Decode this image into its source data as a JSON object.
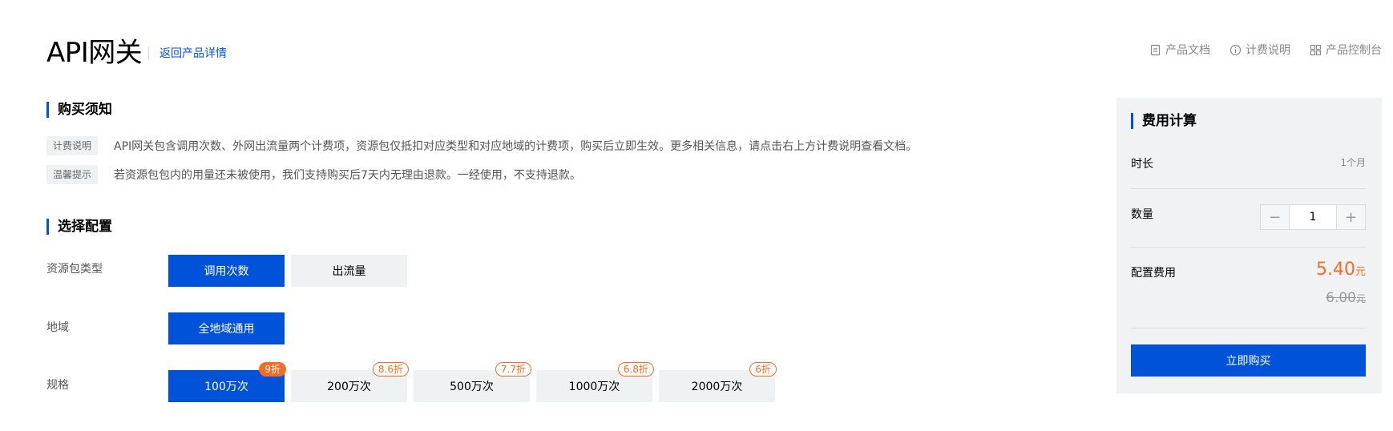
{
  "header": {
    "title": "API网关",
    "back_link": "返回产品详情",
    "links": [
      {
        "label": "产品文档",
        "icon": "doc-icon"
      },
      {
        "label": "计费说明",
        "icon": "info-icon"
      },
      {
        "label": "产品控制台",
        "icon": "grid-icon"
      }
    ]
  },
  "notice": {
    "title": "购买须知",
    "items": [
      {
        "tag": "计费说明",
        "text": "API网关包含调用次数、外网出流量两个计费项，资源包仅抵扣对应类型和对应地域的计费项，购买后立即生效。更多相关信息，请点击右上方计费说明查看文档。"
      },
      {
        "tag": "温馨提示",
        "text": "若资源包包内的用量还未被使用，我们支持购买后7天内无理由退款。一经使用，不支持退款。"
      }
    ]
  },
  "config": {
    "title": "选择配置",
    "package_type": {
      "label": "资源包类型",
      "options": [
        "调用次数",
        "出流量"
      ],
      "selected": "调用次数"
    },
    "region": {
      "label": "地域",
      "options": [
        "全地域通用"
      ],
      "selected": "全地域通用"
    },
    "spec": {
      "label": "规格",
      "options": [
        {
          "label": "100万次",
          "discount": "9折"
        },
        {
          "label": "200万次",
          "discount": "8.6折"
        },
        {
          "label": "500万次",
          "discount": "7.7折"
        },
        {
          "label": "1000万次",
          "discount": "6.8折"
        },
        {
          "label": "2000万次",
          "discount": "6折"
        }
      ],
      "selected": "100万次"
    }
  },
  "cost": {
    "title": "费用计算",
    "duration_label": "时长",
    "duration_value": "1个月",
    "quantity_label": "数量",
    "quantity_value": "1",
    "minus": "−",
    "plus": "+",
    "fee_label": "配置费用",
    "price": "5.40",
    "price_unit": "元",
    "original_price": "6.00",
    "original_unit": "元",
    "buy_label": "立即购买"
  },
  "colors": {
    "brand": "#0052d9",
    "accent": "#f76c22"
  }
}
